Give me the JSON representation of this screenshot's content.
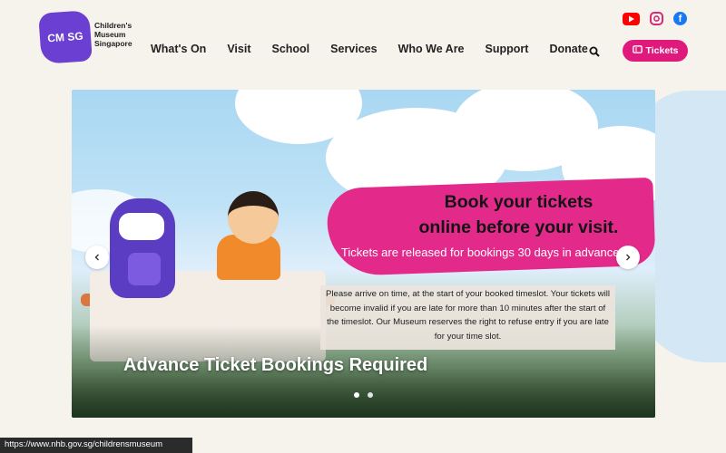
{
  "header": {
    "logo_mark": "CM SG",
    "logo_text": "Children's Museum Singapore",
    "nav": [
      "What's On",
      "Visit",
      "School",
      "Services",
      "Who We Are",
      "Support",
      "Donate"
    ],
    "tickets_label": "Tickets",
    "social_icons": [
      "youtube-icon",
      "instagram-icon",
      "facebook-icon"
    ]
  },
  "hero": {
    "title_line1": "Book your tickets",
    "title_line2": "online before your visit.",
    "subtitle": "Tickets are released for bookings 30 days in advance.",
    "notice": "Please arrive on time, at the start of your booked timeslot. Your tickets will become invalid if you are late for more than 10 minutes after the start of the timeslot. Our Museum reserves the right to refuse entry if you are late for your time slot.",
    "heading": "Advance Ticket Bookings Required",
    "slide_count": 2,
    "active_slide": 1
  },
  "colors": {
    "brand_purple": "#6a3fd1",
    "accent_pink": "#e0197d",
    "background": "#f6f2ec"
  },
  "status_bar": {
    "url": "https://www.nhb.gov.sg/childrensmuseum"
  }
}
